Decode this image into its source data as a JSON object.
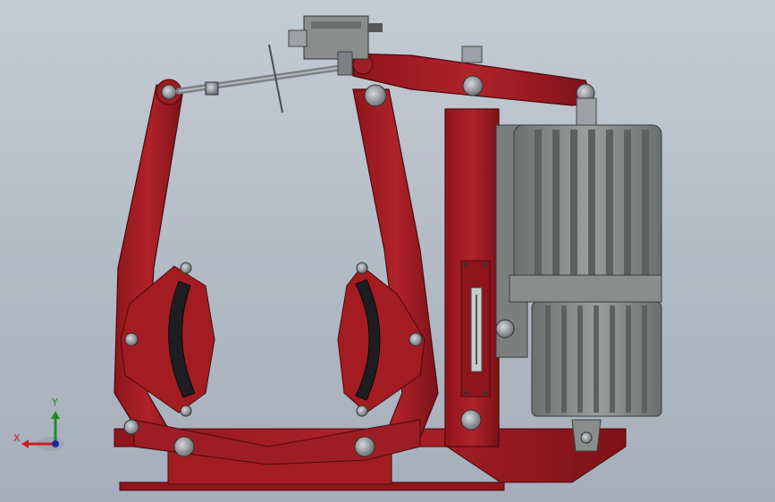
{
  "viewport": {
    "background": "#b9c1cc",
    "colors": {
      "frame_red": "#a31c22",
      "frame_red_dark": "#6e1014",
      "frame_red_light": "#c4343a",
      "motor_grey": "#8a8d8c",
      "motor_grey_dark": "#5c605f",
      "lining_black": "#1e1e22",
      "bolt_grey": "#9ea2a6"
    }
  },
  "triad": {
    "x_label": "X",
    "y_label": "Y",
    "colors": {
      "x": "#c8201e",
      "y": "#1e8c28",
      "z": "#1c2ca8"
    }
  }
}
